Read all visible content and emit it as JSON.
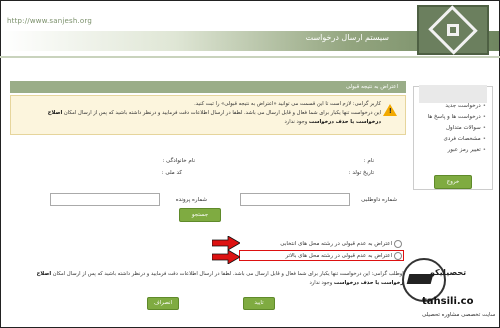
{
  "header": {
    "url": "http://www.sanjesh.org",
    "title": "سیستم ارسال درخواست"
  },
  "sidebar": {
    "items": [
      {
        "label": "درخواست جدید"
      },
      {
        "label": "درخواست ها و پاسخ ها"
      },
      {
        "label": "سوالات متداول"
      },
      {
        "label": "مشخصات فردی"
      },
      {
        "label": "تغییر رمز عبور"
      }
    ],
    "exit_label": "خروج"
  },
  "panel": {
    "title": "اعتراض به نتیجه قبولی",
    "warning_line1": "کاربر گرامی: لازم است تا این قسمت می توانید «اعتراض به نتیجه قبولی» را ثبت کنید.",
    "warning_line2": "این درخواست تنها یکبار برای شما فعال و قابل ارسال می باشد. لطفا در ارسال اطلاعات دقت فرمایید و درنظر داشته باشید که پس از ارسال امکان",
    "warning_bold": "اصلاح درخواست یا حذف درخواست",
    "warning_end": "وجود ندارد"
  },
  "form": {
    "name_label": "نام :",
    "family_label": "نام خانوادگی :",
    "birth_label": "تاریخ تولد :",
    "national_label": "کد ملی :",
    "volunteer_label": "شماره داوطلبی",
    "file_label": "شماره پرونده",
    "search_label": "جستجو"
  },
  "options": [
    {
      "label": "اعتراض به عدم قبولی در رشته محل های انتخابی"
    },
    {
      "label": "اعتراض به عدم قبولی در رشته محل های بالاتر"
    }
  ],
  "note": {
    "text": "داوطلب گرامی: این درخواست تنها یکبار برای شما فعال و قابل ارسال می باشد. لطفا در ارسال اطلاعات دقت فرمایید و درنظر داشته باشید که پس از ارسال امکان",
    "bold": "اصلاح درخواست یا حذف درخواست",
    "end": "وجود ندارد"
  },
  "buttons": {
    "confirm": "تایید",
    "cancel": "انصراف"
  },
  "watermark": {
    "brand": "تحصیلیکو",
    "site": "tahsili.co",
    "sub": "سایت تخصصی مشاوره تحصیلی"
  },
  "colors": {
    "accent": "#7fab41",
    "panel_header": "#9aad88",
    "warning_bg": "#fcf5dd",
    "highlight": "#dd1111",
    "arrow": "#dd1111"
  }
}
